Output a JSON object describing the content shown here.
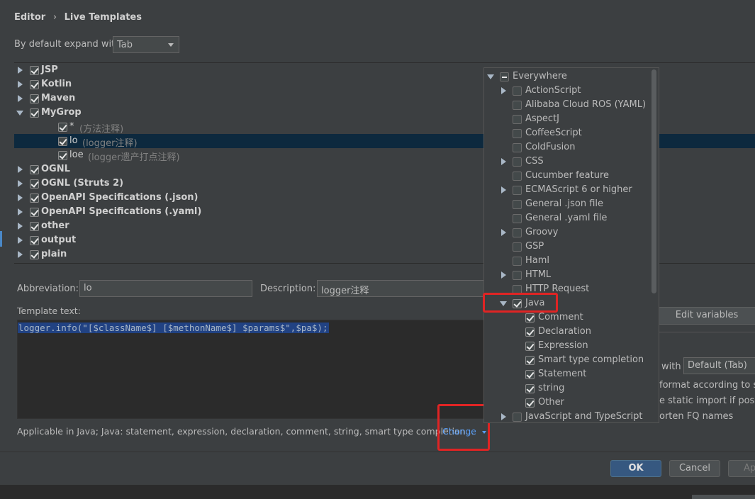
{
  "breadcrumb": {
    "part1": "Editor",
    "separator": "›",
    "part2": "Live Templates"
  },
  "expand": {
    "label": "By default expand with",
    "value": "Tab"
  },
  "tree": [
    {
      "label": "JSP",
      "bold": true,
      "expanded": false,
      "checked": true
    },
    {
      "label": "Kotlin",
      "bold": true,
      "expanded": false,
      "checked": true
    },
    {
      "label": "Maven",
      "bold": true,
      "expanded": false,
      "checked": true
    },
    {
      "label": "MyGrop",
      "bold": true,
      "expanded": true,
      "checked": true
    },
    {
      "label": "*",
      "desc": "(方法注释)",
      "child": true,
      "checked": true
    },
    {
      "label": "lo",
      "desc": "(logger注释)",
      "child": true,
      "checked": true,
      "selected": true
    },
    {
      "label": "loe",
      "desc": "(logger遗产打点注释)",
      "child": true,
      "checked": true
    },
    {
      "label": "OGNL",
      "bold": true,
      "expanded": false,
      "checked": true
    },
    {
      "label": "OGNL (Struts 2)",
      "bold": true,
      "expanded": false,
      "checked": true
    },
    {
      "label": "OpenAPI Specifications (.json)",
      "bold": true,
      "expanded": false,
      "checked": true
    },
    {
      "label": "OpenAPI Specifications (.yaml)",
      "bold": true,
      "expanded": false,
      "checked": true
    },
    {
      "label": "other",
      "bold": true,
      "expanded": false,
      "checked": true
    },
    {
      "label": "output",
      "bold": true,
      "expanded": false,
      "checked": true
    },
    {
      "label": "plain",
      "bold": true,
      "expanded": false,
      "checked": true
    }
  ],
  "abbreviation": {
    "label": "Abbreviation:",
    "value": "lo"
  },
  "description": {
    "label": "Description:",
    "value": "logger注释"
  },
  "template": {
    "label": "Template text:",
    "code": "logger.info(\"[$className$] [$methonName$] $params$\",$pa$);"
  },
  "applicable": {
    "text": "Applicable in Java; Java: statement, expression, declaration, comment, string, smart type completion...",
    "change": "Change"
  },
  "right_panel": {
    "edit_variables": "Edit variables",
    "expand_with_label": "with",
    "expand_with_value": "Default (Tab)",
    "option1": "format according to sty",
    "option2": "e static import if possib",
    "option3": "orten FQ names"
  },
  "popup": [
    {
      "label": "Everywhere",
      "level": 0,
      "arrow": "down",
      "state": "partial"
    },
    {
      "label": "ActionScript",
      "level": 1,
      "arrow": "right",
      "state": "unchecked"
    },
    {
      "label": "Alibaba Cloud ROS (YAML)",
      "level": 1,
      "arrow": "",
      "state": "unchecked"
    },
    {
      "label": "AspectJ",
      "level": 1,
      "arrow": "",
      "state": "unchecked"
    },
    {
      "label": "CoffeeScript",
      "level": 1,
      "arrow": "",
      "state": "unchecked"
    },
    {
      "label": "ColdFusion",
      "level": 1,
      "arrow": "",
      "state": "unchecked"
    },
    {
      "label": "CSS",
      "level": 1,
      "arrow": "right",
      "state": "unchecked"
    },
    {
      "label": "Cucumber feature",
      "level": 1,
      "arrow": "",
      "state": "unchecked"
    },
    {
      "label": "ECMAScript 6 or higher",
      "level": 1,
      "arrow": "right",
      "state": "unchecked"
    },
    {
      "label": "General .json file",
      "level": 1,
      "arrow": "",
      "state": "unchecked"
    },
    {
      "label": "General .yaml file",
      "level": 1,
      "arrow": "",
      "state": "unchecked"
    },
    {
      "label": "Groovy",
      "level": 1,
      "arrow": "right",
      "state": "unchecked"
    },
    {
      "label": "GSP",
      "level": 1,
      "arrow": "",
      "state": "unchecked"
    },
    {
      "label": "Haml",
      "level": 1,
      "arrow": "",
      "state": "unchecked"
    },
    {
      "label": "HTML",
      "level": 1,
      "arrow": "right",
      "state": "unchecked"
    },
    {
      "label": "HTTP Request",
      "level": 1,
      "arrow": "",
      "state": "unchecked"
    },
    {
      "label": "Java",
      "level": 1,
      "arrow": "down",
      "state": "checked"
    },
    {
      "label": "Comment",
      "level": 2,
      "arrow": "",
      "state": "checked"
    },
    {
      "label": "Declaration",
      "level": 2,
      "arrow": "",
      "state": "checked"
    },
    {
      "label": "Expression",
      "level": 2,
      "arrow": "",
      "state": "checked"
    },
    {
      "label": "Smart type completion",
      "level": 2,
      "arrow": "",
      "state": "checked"
    },
    {
      "label": "Statement",
      "level": 2,
      "arrow": "",
      "state": "checked"
    },
    {
      "label": "string",
      "level": 2,
      "arrow": "",
      "state": "checked"
    },
    {
      "label": "Other",
      "level": 2,
      "arrow": "",
      "state": "checked"
    },
    {
      "label": "JavaScript and TypeScript",
      "level": 1,
      "arrow": "right",
      "state": "unchecked"
    }
  ],
  "buttons": {
    "ok": "OK",
    "cancel": "Cancel",
    "apply": "Ap"
  },
  "colors": {
    "accent": "#4a88c7",
    "selection": "#0d293e",
    "highlight": "#e02424",
    "link": "#589df6"
  }
}
